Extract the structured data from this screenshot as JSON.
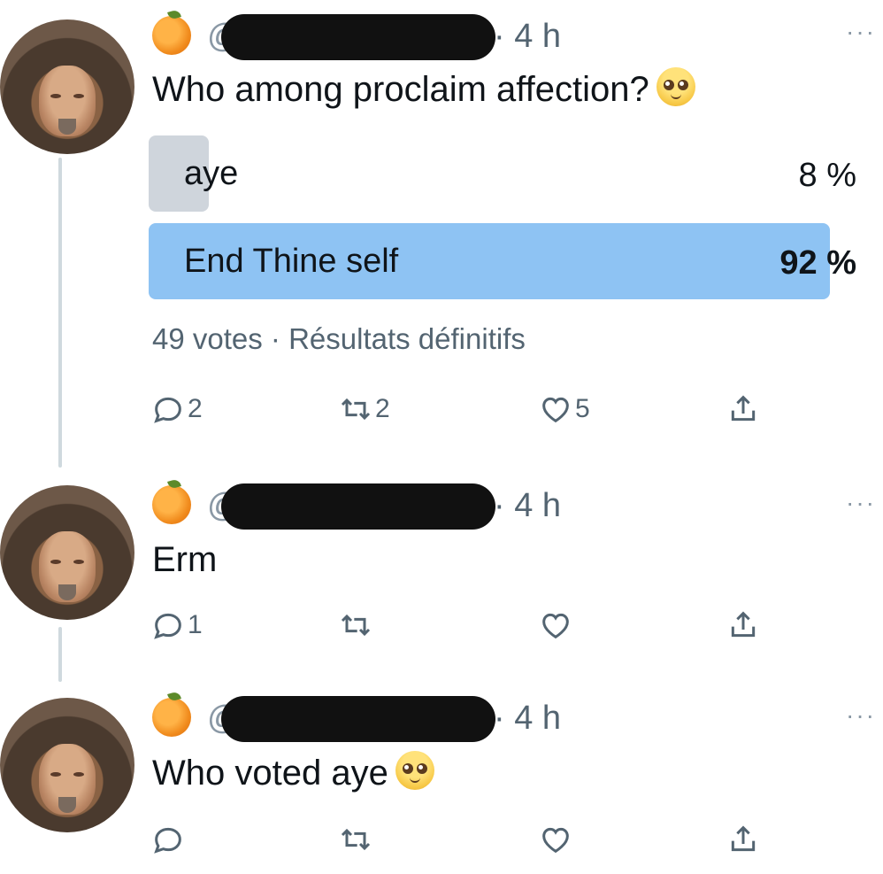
{
  "tweets": [
    {
      "time": "4 h",
      "text": "Who among proclaim affection?",
      "handle_prefix": "@",
      "emoji": "pleading-face",
      "poll": {
        "options": [
          {
            "label": "aye",
            "percent_text": "8 %",
            "value": 8
          },
          {
            "label": "End Thine self",
            "percent_text": "92 %",
            "value": 92
          }
        ],
        "meta": "49 votes · Résultats définitifs"
      },
      "actions": {
        "reply": "2",
        "retweet": "2",
        "like": "5"
      }
    },
    {
      "time": "4 h",
      "text": "Erm",
      "handle_prefix": "@",
      "actions": {
        "reply": "1",
        "retweet": "",
        "like": ""
      }
    },
    {
      "time": "4 h",
      "text": "Who voted aye",
      "handle_prefix": "@",
      "emoji": "pleading-face",
      "actions": {
        "reply": "",
        "retweet": "",
        "like": ""
      }
    }
  ],
  "more_label": "···",
  "colors": {
    "poll_win": "#8ec3f3",
    "poll_lose": "#cfd5dc",
    "thread_line": "#cfd9de",
    "secondary_text": "#536471"
  }
}
